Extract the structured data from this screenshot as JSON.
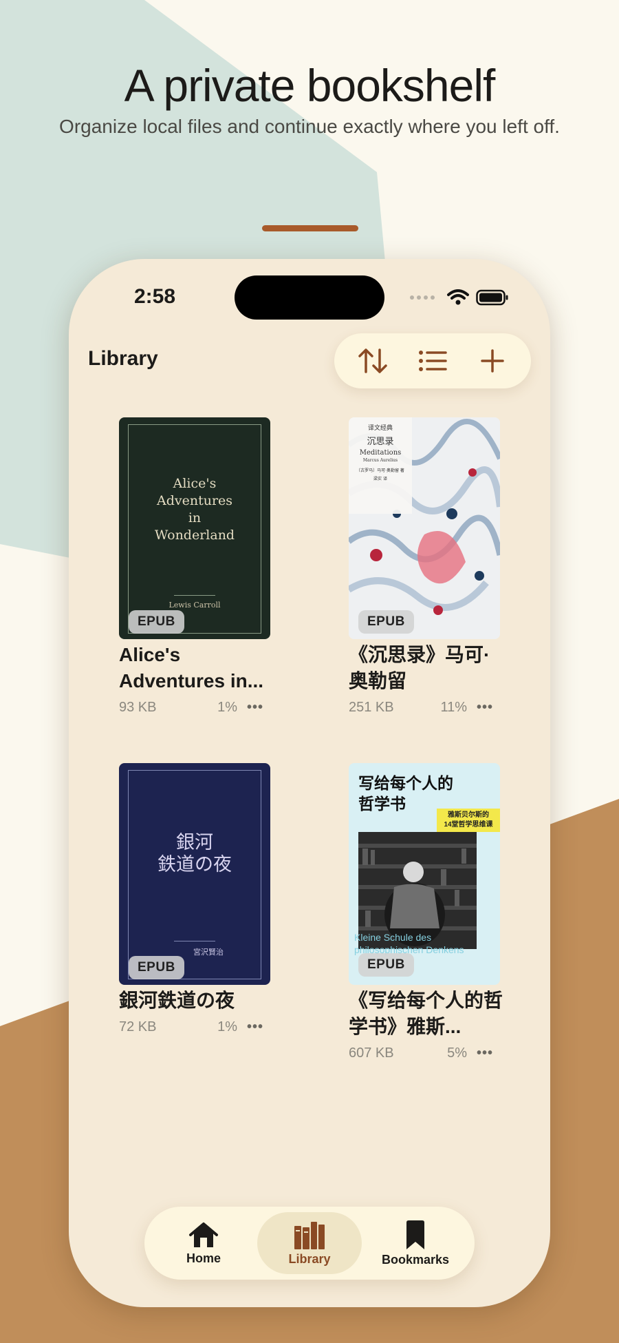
{
  "promo": {
    "headline": "A private bookshelf",
    "subline": "Organize local files and continue exactly where you left off."
  },
  "status_bar": {
    "time": "2:58"
  },
  "header": {
    "title": "Library",
    "toolbar": {
      "sort_icon": "sort-arrows-icon",
      "list_icon": "list-view-icon",
      "add_icon": "plus-icon"
    }
  },
  "books": [
    {
      "title": "Alice's Adventures in...",
      "cover_title": [
        "Alice's",
        "Adventures",
        "in",
        "Wonderland"
      ],
      "cover_author": "Lewis Carroll",
      "format": "EPUB",
      "size": "93 KB",
      "progress": "1%"
    },
    {
      "title": "《沉思录》马可·奥勒留",
      "cover_series": "译文经典",
      "cover_title": "沉思录",
      "cover_subtitle": "Meditations",
      "cover_latin": "Marcus Aurelius",
      "cover_author": "〔古罗马〕马可·奥勒留 著",
      "cover_translator": "梁实 译",
      "format": "EPUB",
      "size": "251 KB",
      "progress": "11%"
    },
    {
      "title": "銀河鉄道の夜",
      "cover_title": [
        "銀河",
        "鉄道の夜"
      ],
      "cover_author": "宮沢賢治",
      "format": "EPUB",
      "size": "72 KB",
      "progress": "1%"
    },
    {
      "title": "《写给每个人的哲学书》雅斯...",
      "cover_title": [
        "写给每个人的",
        "哲学书"
      ],
      "cover_tag": [
        "雅斯贝尔斯的",
        "14堂哲学思维课"
      ],
      "cover_german": [
        "Kleine Schule des",
        "philosophischen Denkens"
      ],
      "format": "EPUB",
      "size": "607 KB",
      "progress": "5%"
    }
  ],
  "more_glyph": "•••",
  "tabbar": {
    "tabs": [
      {
        "label": "Home",
        "icon": "house-icon"
      },
      {
        "label": "Library",
        "icon": "books-icon",
        "active": true
      },
      {
        "label": "Bookmarks",
        "icon": "bookmark-icon"
      }
    ]
  },
  "colors": {
    "accent": "#8a4a24",
    "background": "#fbf8ee",
    "phone": "#f5ead7",
    "sage": "#d3e3dc",
    "tan": "#c08e5a"
  }
}
